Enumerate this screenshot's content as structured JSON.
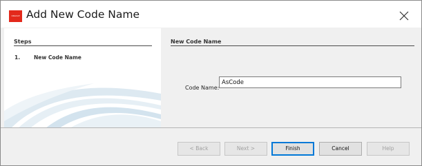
{
  "window": {
    "title": "Add New Code Name",
    "logo_text": "ORACLE"
  },
  "steps_panel": {
    "header": "Steps",
    "steps": [
      {
        "number": "1.",
        "label": "New Code Name"
      }
    ]
  },
  "main_panel": {
    "section_header": "New Code Name",
    "code_name_label": "Code Name:",
    "code_name_value": "AsCode"
  },
  "buttons": {
    "back": "< Back",
    "next": "Next >",
    "finish": "Finish",
    "cancel": "Cancel",
    "help": "Help"
  },
  "colors": {
    "logo_red": "#e3291b",
    "focus_blue": "#0078d7",
    "swoosh_blue": "#cfe2ee"
  }
}
